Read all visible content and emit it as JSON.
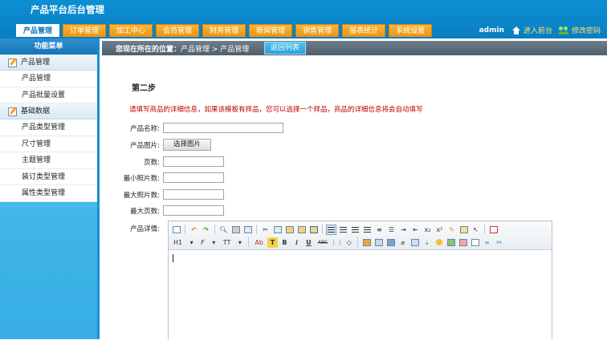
{
  "header": {
    "title": "产品平台后台管理",
    "tabs": [
      {
        "label": "产品管理",
        "active": true
      },
      {
        "label": "订单管理",
        "active": false
      },
      {
        "label": "加工中心",
        "active": false
      },
      {
        "label": "会员管理",
        "active": false
      },
      {
        "label": "财务管理",
        "active": false
      },
      {
        "label": "新闻管理",
        "active": false
      },
      {
        "label": "销售管理",
        "active": false
      },
      {
        "label": "报表统计",
        "active": false
      },
      {
        "label": "系统设置",
        "active": false
      }
    ],
    "username": "admin",
    "enter_front_label": "进入前台",
    "change_password_label": "修改密码"
  },
  "sidebar": {
    "title": "功能菜单",
    "sections": [
      {
        "title": "产品管理",
        "icon": "edit-icon",
        "items": [
          "产品管理",
          "产品批量设置"
        ]
      },
      {
        "title": "基础数据",
        "icon": "edit-icon",
        "items": [
          "产品类型管理",
          "尺寸管理",
          "主题管理",
          "装订类型管理",
          "属性类型管理"
        ]
      }
    ]
  },
  "breadcrumb": {
    "label": "您现在所在的位置：",
    "path": "产品管理 > 产品管理",
    "back_button": "返回列表"
  },
  "form": {
    "step_title": "第二步",
    "hint": "请填写商品的详细信息，如果该模板有样品，您可以选择一个样品，商品的详细信息将会自动填写",
    "fields": {
      "product_name": {
        "label": "产品名称:",
        "value": ""
      },
      "product_image": {
        "label": "产品图片:",
        "button": "选择图片"
      },
      "pages": {
        "label": "页数:",
        "value": ""
      },
      "min_photos": {
        "label": "最小照片数:",
        "value": ""
      },
      "max_photos": {
        "label": "最大照片数:",
        "value": ""
      },
      "max_pages": {
        "label": "最大页数:",
        "value": ""
      },
      "details": {
        "label": "产品详情:"
      }
    }
  },
  "editor": {
    "toolbar_row1": [
      "source",
      "undo",
      "redo",
      "preview",
      "print",
      "template",
      "cut",
      "copy",
      "paste",
      "paste-text",
      "paste-word",
      "align-left",
      "align-center",
      "align-right",
      "justify",
      "ordered-list",
      "unordered-list",
      "indent",
      "outdent",
      "subscript",
      "superscript",
      "clear-format",
      "select-all",
      "cursor",
      "fullscreen"
    ],
    "toolbar_row2_text": [
      "H1",
      "F",
      "TT",
      "Ab",
      "T",
      "B",
      "I",
      "U",
      "ABC"
    ],
    "toolbar_row2_icons": [
      "table-grid",
      "eraser",
      "image-insert",
      "flash",
      "media",
      "attach",
      "table",
      "hr",
      "emoticon",
      "map",
      "page-break",
      "anchor",
      "link",
      "unlink"
    ]
  },
  "colors": {
    "header_blue": "#0a7ec2",
    "tab_orange": "#ec9310",
    "hint_red": "#c00000",
    "sidebar_blue": "#3fb5e8"
  }
}
